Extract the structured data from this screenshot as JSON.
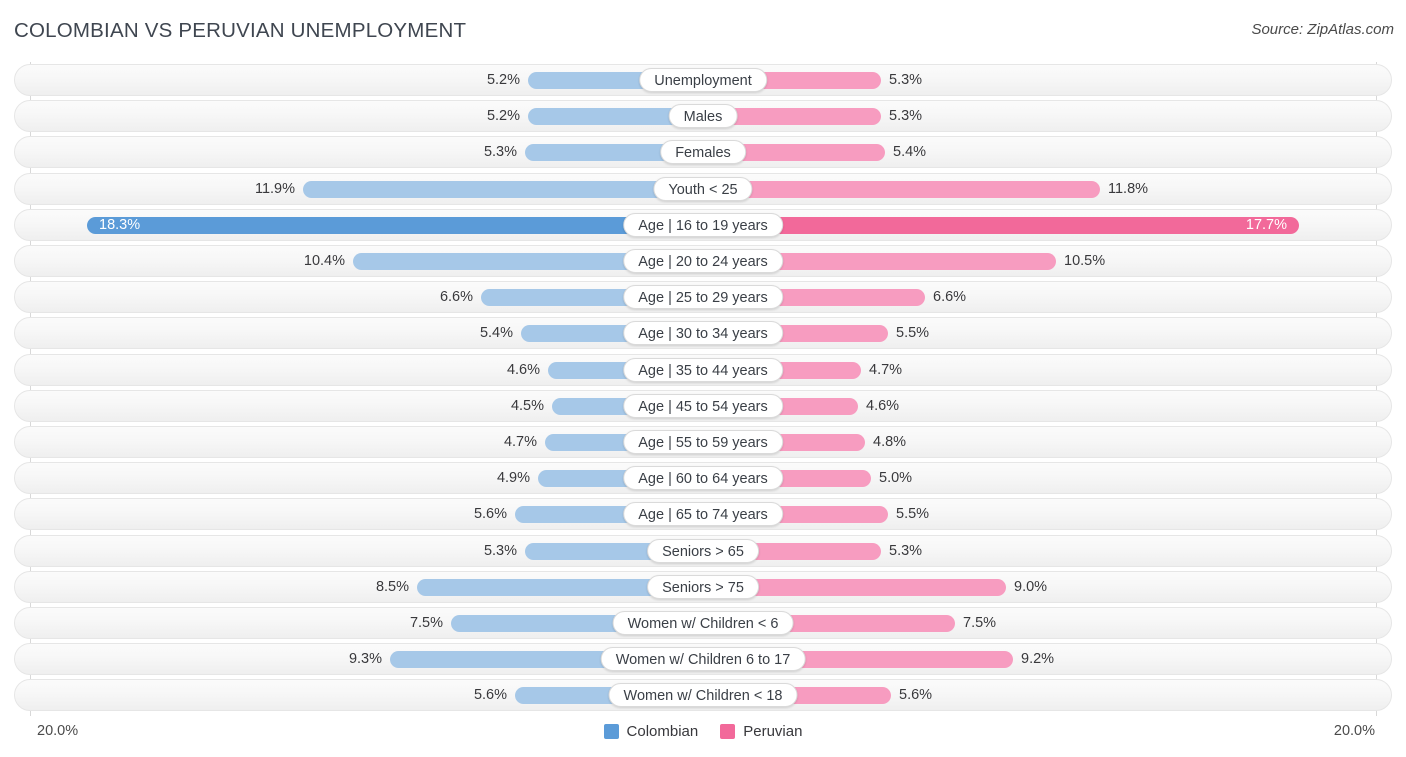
{
  "header": {
    "title": "COLOMBIAN VS PERUVIAN UNEMPLOYMENT",
    "source": "Source: ZipAtlas.com"
  },
  "footer": {
    "axis_left": "20.0%",
    "axis_right": "20.0%",
    "legend": [
      {
        "label": "Colombian",
        "color": "#5b9bd8",
        "name": "legend-colombian"
      },
      {
        "label": "Peruvian",
        "color": "#f2699a",
        "name": "legend-peruvian"
      }
    ]
  },
  "colors": {
    "left_normal": "#a6c8e8",
    "left_highlight": "#5b9bd8",
    "right_normal": "#f79cc0",
    "right_highlight": "#f2699a",
    "track": "#f7f7f7"
  },
  "chart_data": {
    "type": "bar",
    "orientation": "horizontal-diverging",
    "title": "COLOMBIAN VS PERUVIAN UNEMPLOYMENT",
    "xlabel": "",
    "ylabel": "",
    "xlim": [
      0,
      20
    ],
    "axis_max_label": "20.0%",
    "grid": false,
    "legend_position": "bottom-center",
    "categories": [
      "Unemployment",
      "Males",
      "Females",
      "Youth < 25",
      "Age | 16 to 19 years",
      "Age | 20 to 24 years",
      "Age | 25 to 29 years",
      "Age | 30 to 34 years",
      "Age | 35 to 44 years",
      "Age | 45 to 54 years",
      "Age | 55 to 59 years",
      "Age | 60 to 64 years",
      "Age | 65 to 74 years",
      "Seniors > 65",
      "Seniors > 75",
      "Women w/ Children < 6",
      "Women w/ Children 6 to 17",
      "Women w/ Children < 18"
    ],
    "series": [
      {
        "name": "Colombian",
        "color": "#a6c8e8",
        "values": [
          5.2,
          5.2,
          5.3,
          11.9,
          18.3,
          10.4,
          6.6,
          5.4,
          4.6,
          4.5,
          4.7,
          4.9,
          5.6,
          5.3,
          8.5,
          7.5,
          9.3,
          5.6
        ],
        "labels": [
          "5.2%",
          "5.2%",
          "5.3%",
          "11.9%",
          "18.3%",
          "10.4%",
          "6.6%",
          "5.4%",
          "4.6%",
          "4.5%",
          "4.7%",
          "4.9%",
          "5.6%",
          "5.3%",
          "8.5%",
          "7.5%",
          "9.3%",
          "5.6%"
        ]
      },
      {
        "name": "Peruvian",
        "color": "#f79cc0",
        "values": [
          5.3,
          5.3,
          5.4,
          11.8,
          17.7,
          10.5,
          6.6,
          5.5,
          4.7,
          4.6,
          4.8,
          5.0,
          5.5,
          5.3,
          9.0,
          7.5,
          9.2,
          5.6
        ],
        "labels": [
          "5.3%",
          "5.3%",
          "5.4%",
          "11.8%",
          "17.7%",
          "10.5%",
          "6.6%",
          "5.5%",
          "4.7%",
          "4.6%",
          "4.8%",
          "5.0%",
          "5.5%",
          "5.3%",
          "9.0%",
          "7.5%",
          "9.2%",
          "5.6%"
        ]
      }
    ],
    "highlighted_row_index": 4
  }
}
